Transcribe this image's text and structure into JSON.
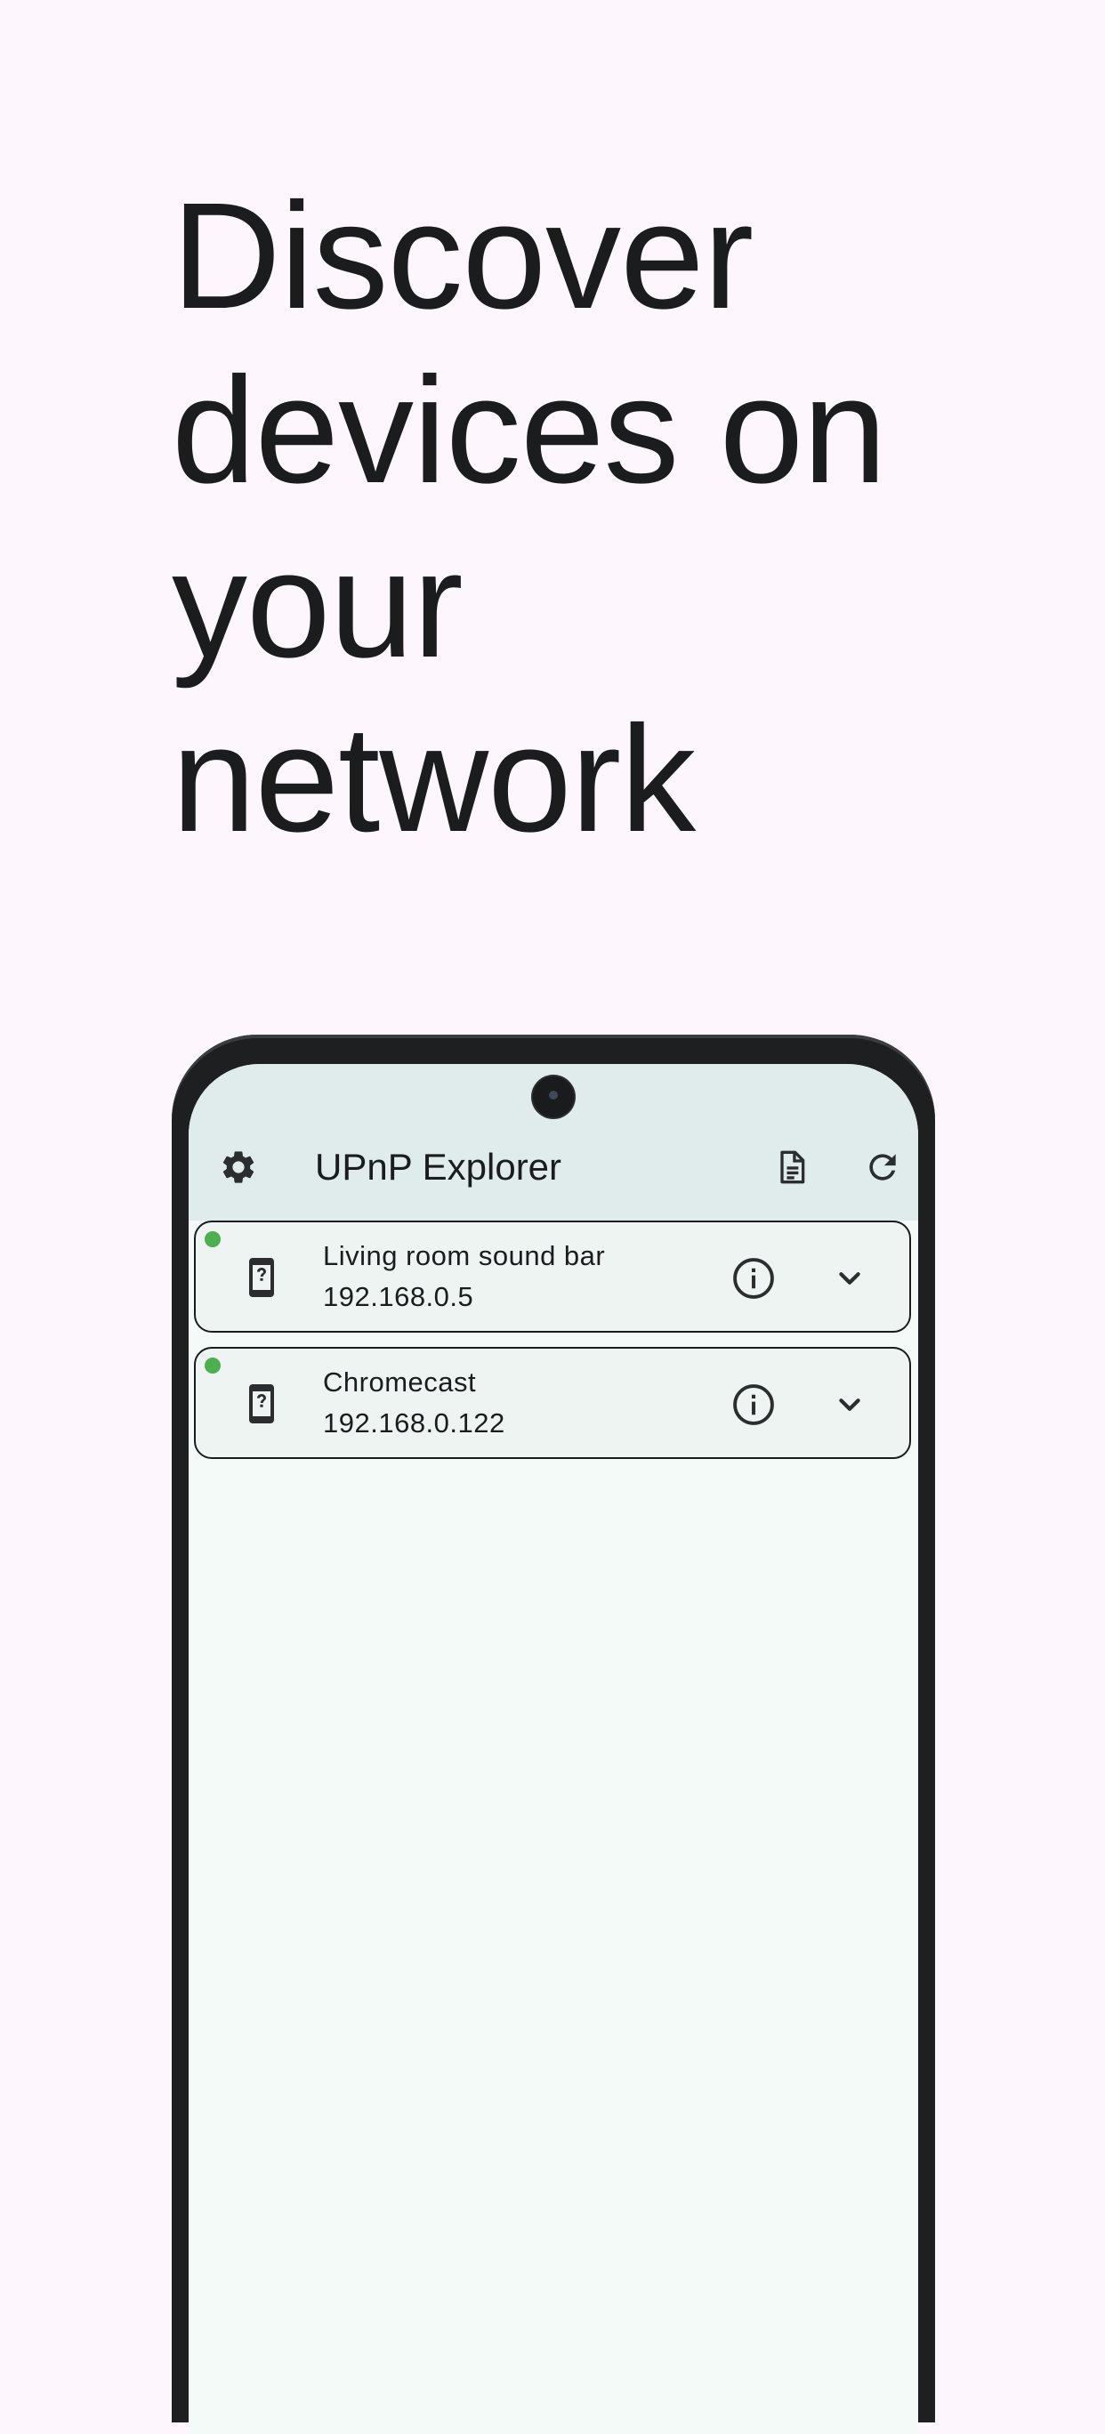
{
  "headline": {
    "lines": [
      "Discover",
      "devices on",
      "your",
      "network"
    ]
  },
  "app": {
    "title": "UPnP Explorer",
    "icons": {
      "settings": "gear-icon",
      "logs": "document-icon",
      "refresh": "refresh-icon"
    }
  },
  "devices": [
    {
      "name": "Living room sound bar",
      "ip": "192.168.0.5",
      "status_color": "#4caf50",
      "icon": "unknown-device-icon"
    },
    {
      "name": "Chromecast",
      "ip": "192.168.0.122",
      "status_color": "#4caf50",
      "icon": "unknown-device-icon"
    }
  ],
  "colors": {
    "background": "#fdf7fd",
    "app_bar": "#dfeceb",
    "screen": "#f4faf7",
    "card": "#edf4f1",
    "status_online": "#4caf50"
  }
}
